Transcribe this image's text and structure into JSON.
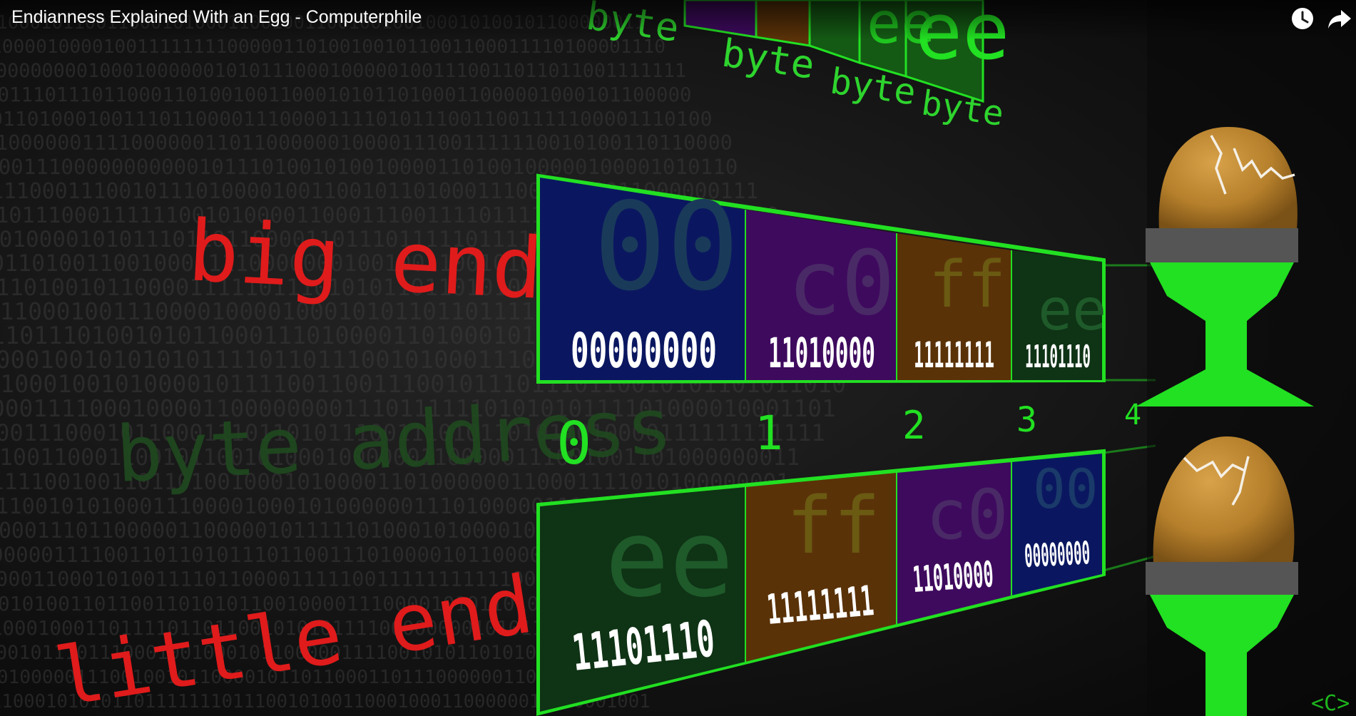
{
  "video": {
    "title": "Endianness Explained With an Egg - Computerphile",
    "watch_later_icon": "clock-icon",
    "share_icon": "share-arrow-icon",
    "channel_watermark": "<C>"
  },
  "colors": {
    "green": "#22e022",
    "red": "#e01b1b",
    "blue": "#0a1760",
    "purple": "#3e0a5e",
    "brown": "#5a3208",
    "darkgreen": "#0f3315"
  },
  "labels": {
    "big_endian": "big endian",
    "little_endian": "little endian",
    "byte_address": "byte address"
  },
  "top_bytes": {
    "byte_labels": [
      "byte",
      "byte",
      "byte",
      "byte"
    ],
    "hex": [
      "ee",
      "ee"
    ]
  },
  "big_endian_bytes": [
    {
      "hex": "00",
      "bin": "00000000",
      "color": "blue"
    },
    {
      "hex": "c0",
      "bin": "11010000",
      "color": "purple"
    },
    {
      "hex": "ff",
      "bin": "11111111",
      "color": "brown"
    },
    {
      "hex": "ee",
      "bin": "11101110",
      "color": "darkgreen"
    }
  ],
  "addresses": [
    "0",
    "1",
    "2",
    "3",
    "4"
  ],
  "little_endian_bytes": [
    {
      "hex": "ee",
      "bin": "11101110",
      "color": "darkgreen"
    },
    {
      "hex": "ff",
      "bin": "11111111",
      "color": "brown"
    },
    {
      "hex": "c0",
      "bin": "11010000",
      "color": "purple"
    },
    {
      "hex": "00",
      "bin": "00000000",
      "color": "blue"
    }
  ]
}
